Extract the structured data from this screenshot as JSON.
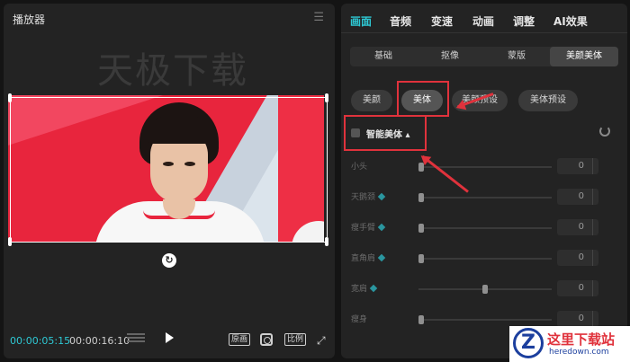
{
  "player": {
    "title": "播放器",
    "menu_icon": "hamburger-icon",
    "watermark": "天极下载",
    "current_time": "00:00:05:15",
    "total_time": "00:00:16:10",
    "original_btn": "原画",
    "ratio_btn": "比例",
    "rotate_icon": "rotate-icon"
  },
  "editor": {
    "tabs": [
      "画面",
      "音频",
      "变速",
      "动画",
      "调整",
      "AI效果"
    ],
    "active_tab": "画面",
    "subtabs": [
      "基础",
      "抠像",
      "蒙版",
      "美颜美体"
    ],
    "active_subtab": "美颜美体",
    "pills": [
      "美颜",
      "美体",
      "美颜预设",
      "美体预设"
    ],
    "active_pill": "美体",
    "ai_body_label": "智能美体 ▴",
    "sliders": [
      {
        "label": "小头",
        "value": "0",
        "level": 0,
        "ai": false
      },
      {
        "label": "天鹅颈",
        "value": "0",
        "level": 0,
        "ai": true
      },
      {
        "label": "瘦手臂",
        "value": "0",
        "level": 0,
        "ai": true
      },
      {
        "label": "直角肩",
        "value": "0",
        "level": 0,
        "ai": true
      },
      {
        "label": "宽肩",
        "value": "0",
        "level": 0.5,
        "ai": true
      },
      {
        "label": "瘦身",
        "value": "0",
        "level": 0,
        "ai": false
      }
    ]
  },
  "logo": {
    "mark": "Z",
    "name": "这里下载站",
    "url": "heredown.com"
  },
  "colors": {
    "accent": "#2ec8d4",
    "highlight": "#e0323c"
  }
}
